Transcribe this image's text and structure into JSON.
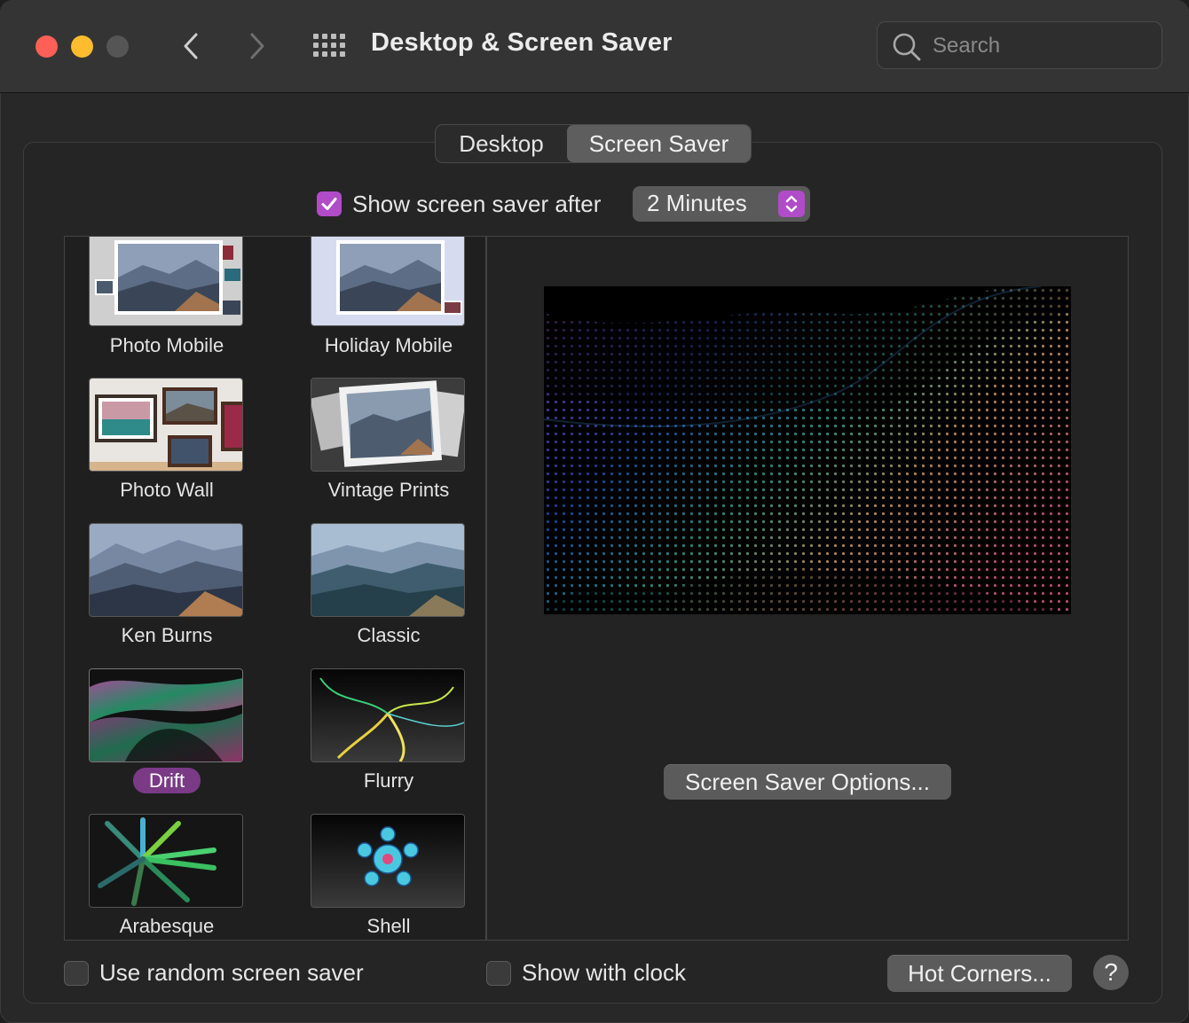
{
  "window": {
    "title": "Desktop & Screen Saver"
  },
  "search": {
    "placeholder": "Search"
  },
  "tabs": [
    {
      "label": "Desktop",
      "active": false
    },
    {
      "label": "Screen Saver",
      "active": true
    }
  ],
  "start_after": {
    "label": "Show screen saver after",
    "checked": true,
    "value": "2 Minutes"
  },
  "savers": [
    {
      "label": "Photo Mobile",
      "selected": false
    },
    {
      "label": "Holiday Mobile",
      "selected": false
    },
    {
      "label": "Photo Wall",
      "selected": false
    },
    {
      "label": "Vintage Prints",
      "selected": false
    },
    {
      "label": "Ken Burns",
      "selected": false
    },
    {
      "label": "Classic",
      "selected": false
    },
    {
      "label": "Drift",
      "selected": true
    },
    {
      "label": "Flurry",
      "selected": false
    },
    {
      "label": "Arabesque",
      "selected": false
    },
    {
      "label": "Shell",
      "selected": false
    }
  ],
  "options_button": "Screen Saver Options...",
  "bottom": {
    "random_label": "Use random screen saver",
    "random_checked": false,
    "clock_label": "Show with clock",
    "clock_checked": false,
    "hot_corners": "Hot Corners...",
    "help": "?"
  },
  "colors": {
    "accent": "#b04cc8",
    "selection": "#7a3a86",
    "close": "#fe5f57",
    "minimize": "#febc2e"
  }
}
